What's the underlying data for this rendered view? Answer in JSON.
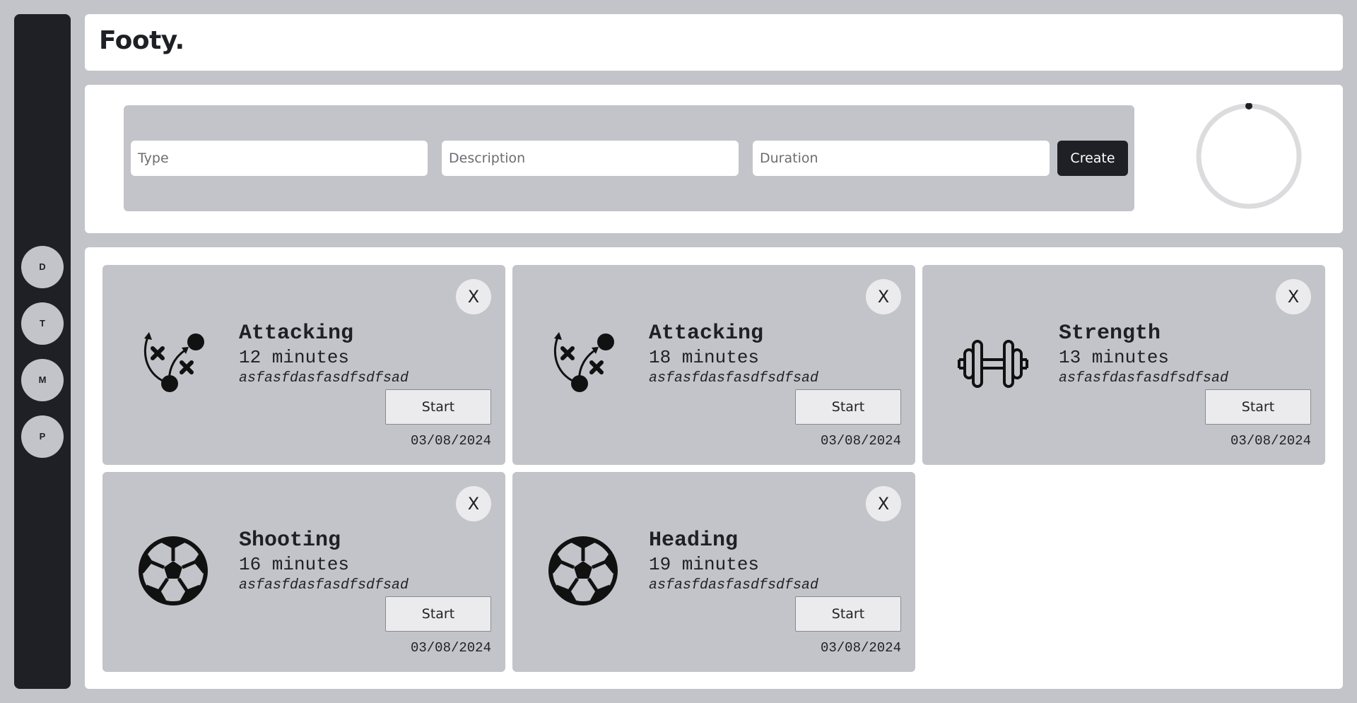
{
  "app": {
    "title": "Footy."
  },
  "sidebar": {
    "items": [
      {
        "label": "D"
      },
      {
        "label": "T"
      },
      {
        "label": "M"
      },
      {
        "label": "P"
      }
    ]
  },
  "form": {
    "type_placeholder": "Type",
    "description_placeholder": "Description",
    "duration_placeholder": "Duration",
    "create_label": "Create"
  },
  "timer": {
    "progress": 0
  },
  "sessions": [
    {
      "type": "Attacking",
      "duration": "12 minutes",
      "description": "asfasfdasfasdfsdfsad",
      "date": "03/08/2024",
      "icon": "tactics-icon",
      "start_label": "Start",
      "close_label": "X"
    },
    {
      "type": "Attacking",
      "duration": "18 minutes",
      "description": "asfasfdasfasdfsdfsad",
      "date": "03/08/2024",
      "icon": "tactics-icon",
      "start_label": "Start",
      "close_label": "X"
    },
    {
      "type": "Strength",
      "duration": "13 minutes",
      "description": "asfasfdasfasdfsdfsad",
      "date": "03/08/2024",
      "icon": "dumbbell-icon",
      "start_label": "Start",
      "close_label": "X"
    },
    {
      "type": "Shooting",
      "duration": "16 minutes",
      "description": "asfasfdasfasdfsdfsad",
      "date": "03/08/2024",
      "icon": "soccer-ball-icon",
      "start_label": "Start",
      "close_label": "X"
    },
    {
      "type": "Heading",
      "duration": "19 minutes",
      "description": "asfasfdasfasdfsdfsad",
      "date": "03/08/2024",
      "icon": "soccer-ball-icon",
      "start_label": "Start",
      "close_label": "X"
    }
  ],
  "colors": {
    "background": "#c3c4c9",
    "sidebar": "#1f2025",
    "panel": "#ffffff",
    "accent": "#1f2025"
  }
}
